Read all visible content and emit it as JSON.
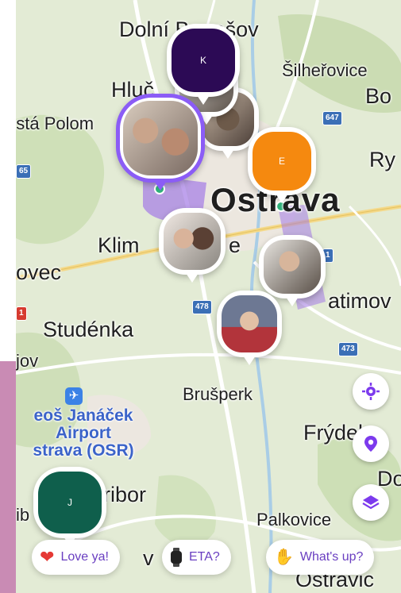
{
  "map": {
    "labels": {
      "dolni_benesov": "Dolní Benešov",
      "silherovice": "Šilheřovice",
      "hlucin": "Hluč",
      "bo": "Bo",
      "usta_polom": "ústá Polom",
      "ry": "Ry",
      "ostrava": "Ostrava",
      "klim": "Klim",
      "klim_e": "e",
      "ovec": "ovec",
      "ratimov": "atimov",
      "studenka": "Studénka",
      "jov": "jov",
      "bruperk": "Brušperk",
      "airport_line1": "eoš Janáček",
      "airport_line2": "Airport",
      "airport_line3": "strava (OSR)",
      "frydek": "Frýdek",
      "fribor": "ribor",
      "do": "Do",
      "ib": "ib",
      "v": "v",
      "palkovice": "Palkovice",
      "ostravice": "Ostravic"
    },
    "road_shields": {
      "r647": "647",
      "r65": "65",
      "r478": "478",
      "r473": "473",
      "r1": "1",
      "r11": "1"
    }
  },
  "avatars": {
    "k_initial": "K",
    "e_initial": "E",
    "j_initial": "J",
    "k_color": "#2c0a55",
    "e_color": "#f5890f",
    "j_color": "#0f5f4c",
    "accent": "#8b5cf6"
  },
  "actions": {
    "love": "Love ya!",
    "eta": "ETA?",
    "whats_up": "What's up?"
  },
  "icons": {
    "locate": "crosshair-icon",
    "places": "location-pin-icon",
    "layers": "layers-icon",
    "airport": "airplane-icon"
  }
}
